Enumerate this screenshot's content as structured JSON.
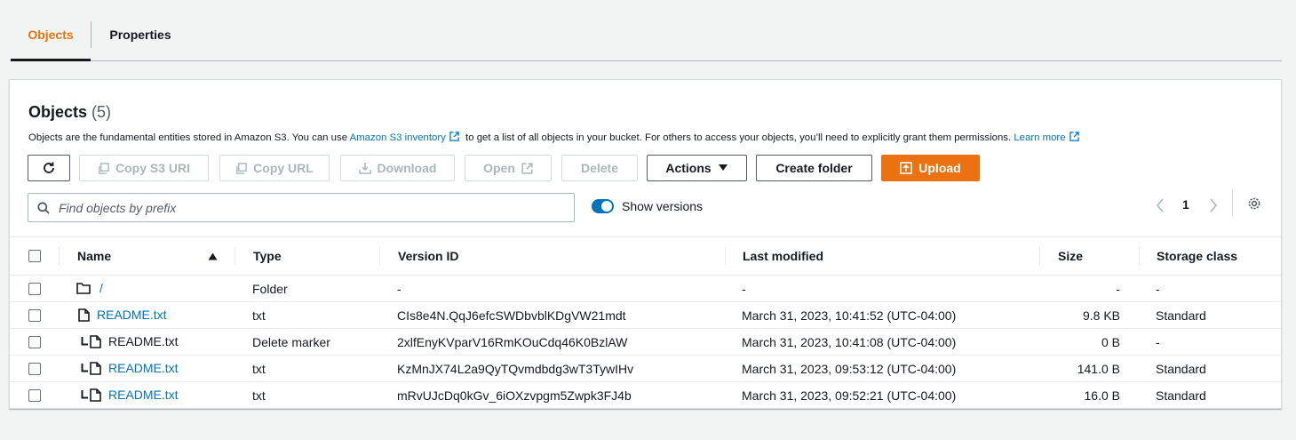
{
  "tabs": [
    {
      "label": "Objects",
      "active": true
    },
    {
      "label": "Properties",
      "active": false
    }
  ],
  "header": {
    "title": "Objects",
    "count": "(5)",
    "desc_before": "Objects are the fundamental entities stored in Amazon S3. You can use ",
    "desc_link1": "Amazon S3 inventory",
    "desc_middle": " to get a list of all objects in your bucket. For others to access your objects, you’ll need to explicitly grant them permissions. ",
    "desc_link2": "Learn more"
  },
  "toolbar": {
    "copy_s3_uri": "Copy S3 URI",
    "copy_url": "Copy URL",
    "download": "Download",
    "open": "Open",
    "delete": "Delete",
    "actions": "Actions",
    "create_folder": "Create folder",
    "upload": "Upload"
  },
  "search": {
    "placeholder": "Find objects by prefix",
    "value": ""
  },
  "show_versions": {
    "label": "Show versions",
    "on": true
  },
  "pagination": {
    "page": "1"
  },
  "table": {
    "columns": [
      "Name",
      "Type",
      "Version ID",
      "Last modified",
      "Size",
      "Storage class"
    ],
    "rows": [
      {
        "name": "/",
        "type": "Folder",
        "version_id": "-",
        "last_modified": "-",
        "size": "-",
        "storage_class": "-",
        "kind": "folder",
        "child": false,
        "link": true
      },
      {
        "name": "README.txt",
        "type": "txt",
        "version_id": "CIs8e4N.QqJ6efcSWDbvblKDgVW21mdt",
        "last_modified": "March 31, 2023, 10:41:52 (UTC-04:00)",
        "size": "9.8 KB",
        "storage_class": "Standard",
        "kind": "file",
        "child": false,
        "link": true
      },
      {
        "name": "README.txt",
        "type": "Delete marker",
        "version_id": "2xlfEnyKVparV16RmKOuCdq46K0BzlAW",
        "last_modified": "March 31, 2023, 10:41:08 (UTC-04:00)",
        "size": "0 B",
        "storage_class": "-",
        "kind": "file",
        "child": true,
        "link": false
      },
      {
        "name": "README.txt",
        "type": "txt",
        "version_id": "KzMnJX74L2a9QyTQvmdbdg3wT3TywIHv",
        "last_modified": "March 31, 2023, 09:53:12 (UTC-04:00)",
        "size": "141.0 B",
        "storage_class": "Standard",
        "kind": "file",
        "child": true,
        "link": true
      },
      {
        "name": "README.txt",
        "type": "txt",
        "version_id": "mRvUJcDq0kGv_6iOXzvpgm5Zwpk3FJ4b",
        "last_modified": "March 31, 2023, 09:52:21 (UTC-04:00)",
        "size": "16.0 B",
        "storage_class": "Standard",
        "kind": "file",
        "child": true,
        "link": true
      }
    ]
  },
  "colors": {
    "accent": "#ec7211",
    "link": "#0073bb",
    "text": "#16191f"
  }
}
